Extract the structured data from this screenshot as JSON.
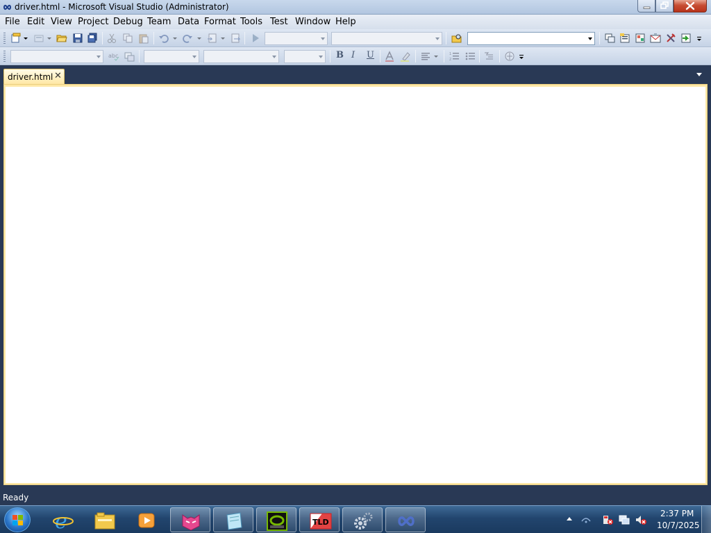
{
  "window": {
    "title": "driver.html - Microsoft Visual Studio (Administrator)",
    "icon": "visual-studio-infinity-icon",
    "controls": [
      "minimize-icon",
      "restore-icon",
      "close-icon"
    ]
  },
  "menu": {
    "items": [
      "File",
      "Edit",
      "View",
      "Project",
      "Debug",
      "Team",
      "Data",
      "Format",
      "Tools",
      "Test",
      "Window",
      "Help"
    ]
  },
  "toolbar_standard": {
    "icons": [
      "new-project-icon",
      "add-item-icon",
      "open-file-icon",
      "save-icon",
      "save-all-icon",
      "cut-icon",
      "copy-icon",
      "paste-icon",
      "undo-icon",
      "redo-icon",
      "navigate-backward-icon",
      "navigate-forward-icon",
      "start-debugging-icon",
      "find-in-files-icon",
      "solution-explorer-icon",
      "properties-icon",
      "object-browser-icon",
      "toolbox-icon",
      "team-explorer-icon",
      "start-page-icon"
    ],
    "search_value": ""
  },
  "toolbar_format": {
    "bold": "B",
    "italic": "I",
    "underline": "U"
  },
  "editor": {
    "tab_label": "driver.html",
    "tab_close": "✕",
    "content": ""
  },
  "status": {
    "text": "Ready"
  },
  "taskbar": {
    "time": "2:37 PM",
    "date": "10/7/2025",
    "apps": [
      "internet-explorer-icon",
      "windows-explorer-icon",
      "media-player-icon",
      "pink-cat-app-icon",
      "notepad-app-icon",
      "nvidia-app-icon",
      "tld-app-icon",
      "settings-gears-app-icon",
      "visual-studio-icon"
    ],
    "tray": [
      "network-icon",
      "action-center-icon",
      "display-icon",
      "volume-muted-icon"
    ],
    "colors": {
      "taskbar": "#22456e",
      "accent": "#293955",
      "tab_active": "#ffe8a6"
    }
  }
}
